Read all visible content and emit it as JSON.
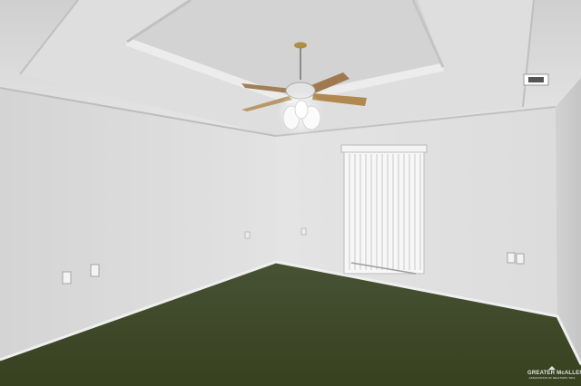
{
  "photo": {
    "subject": "empty-room",
    "colors": {
      "wall": "#d9d9d9",
      "ceiling": "#e8e8e8",
      "carpet": "#404a2b",
      "trim": "#f0f0f0"
    }
  },
  "watermark": {
    "brand": "GREATER McALLEN",
    "tagline": "ASSOCIATION OF REALTORS / MLS"
  }
}
